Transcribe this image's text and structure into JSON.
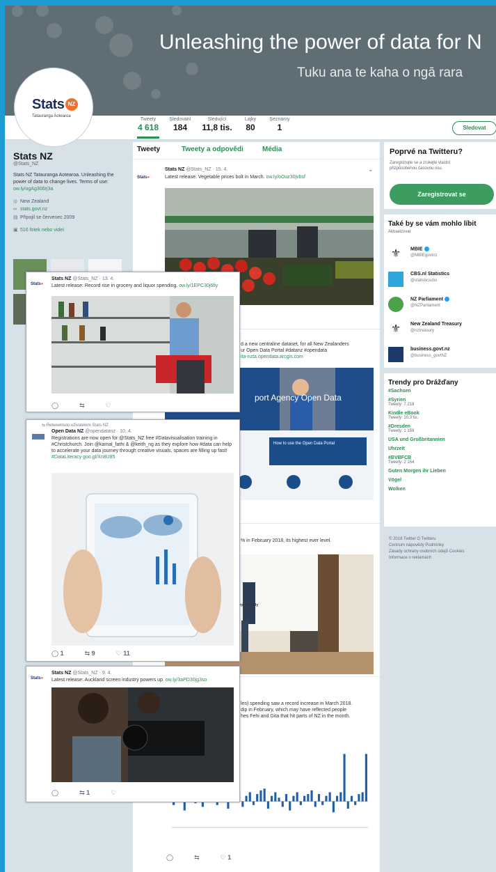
{
  "header": {
    "headline": "Unleashing the power of data for N",
    "subline": "Tuku ana te kaha o ngā rara"
  },
  "logo": {
    "word": "Stats",
    "badge": "NZ",
    "sub": "Tatauranga Aotearoa"
  },
  "stats": [
    {
      "label": "Tweety",
      "value": "4 618"
    },
    {
      "label": "Sledovaní",
      "value": "184"
    },
    {
      "label": "Sledující",
      "value": "11,8 tis."
    },
    {
      "label": "Lajky",
      "value": "80"
    },
    {
      "label": "Seznamy",
      "value": "1"
    }
  ],
  "follow_label": "Sledovat",
  "profile": {
    "name": "Stats NZ",
    "handle": "@Stats_NZ",
    "bio": "Stats NZ Tatauranga Aotearoa. Unleashing the power of data to change lives. Terms of use:",
    "bio_link": "ow.ly/ogAg306rj3a",
    "location": "New Zealand",
    "website": "stats.govt.nz",
    "joined": "Připojil se červenec 2009",
    "photos": "516 fotek nebo videí"
  },
  "tabs": [
    "Tweety",
    "Tweety a odpovědi",
    "Média"
  ],
  "tweets": {
    "t1": {
      "name": "Stats NZ",
      "meta": "@Stats_NZ · 15. 4.",
      "text": "Latest release: Vegetable prices bolt in March.",
      "link": "ow.ly/oOuz30jvbsf"
    },
    "t2": {
      "text": "d a new centraline dataset, for all New Zealanders",
      "text2": "ur Open Data Portal #datanz #opendata",
      "link": "ita-nzta.opendata.arcgis.com"
    },
    "banner": "port Agency Open Data",
    "portal": "How to use the Open Data Portal",
    "t3": {
      "text": "% in February 2018, its highest ever level."
    },
    "t4": {
      "text": "les) spending saw a record increase in March 2018.",
      "text2": "dip in February, which may have reflected people",
      "text3": "hes Fehi and Gita that hit parts of NZ in the month."
    },
    "chart_title": "ers retail card spending, consumables industry, monthly"
  },
  "cards": {
    "c1": {
      "name": "Stats NZ",
      "meta": "@Stats_NZ · 13. 4.",
      "text": "Latest release: Record rise in grocery and liquor spending.",
      "link": "ow.ly/1EPC30j6fiy"
    },
    "c2": {
      "retweet": "Retweetnuto uživatelem Stats NZ",
      "name": "Open Data NZ",
      "meta": "@opendatanz · 10. 4.",
      "text": "Registrations are now open for @Stats_NZ free #Datavisualisation training in #Christchurch. Join @kamal_fathi & @keith_ng as they explore how #data can help to accelerate your data journey through creative visuals, spaces are filling up fast!",
      "link": "#DataLiteracy goo.gl/Xn8U85",
      "reply": "1",
      "rt": "9",
      "like": "11"
    },
    "c3": {
      "name": "Stats NZ",
      "meta": "@Stats_NZ · 9. 4.",
      "text": "Latest release: Auckland screen industry powers up.",
      "link": "ow.ly/3aPD30jg3so",
      "rt": "1"
    }
  },
  "bottom_actions": {
    "like": "1"
  },
  "signup": {
    "heading": "Poprvé na Twitteru?",
    "text": "Zaregistrujte se a získejte vlastní přizpůsobenou časovou osu.",
    "button": "Zaregistrovat se"
  },
  "suggestions": {
    "heading": "Také by se vám mohlo líbit",
    "refresh": "Aktualizovat",
    "items": [
      {
        "name": "MBIE",
        "handle": "@MBIEgovtnz"
      },
      {
        "name": "CBS.nl Statistics",
        "handle": "@statisticscbs"
      },
      {
        "name": "NZ Parliament",
        "handle": "@NZParliament"
      },
      {
        "name": "New Zealand Treasury",
        "handle": "@nztreasury"
      },
      {
        "name": "business.govt.nz",
        "handle": "@business_govtNZ"
      }
    ]
  },
  "trends": {
    "heading": "Trendy pro Drážďany",
    "items": [
      {
        "name": "#Sachsen",
        "sub": ""
      },
      {
        "name": "#Syrien",
        "sub": "Tweety: 7 218"
      },
      {
        "name": "Kindle eBook",
        "sub": "Tweety: 10,3 tis."
      },
      {
        "name": "#Dresden",
        "sub": "Tweety: 1 159"
      },
      {
        "name": "USA und Großbritannien",
        "sub": ""
      },
      {
        "name": "Uhrzeit",
        "sub": ""
      },
      {
        "name": "#BVBFCB",
        "sub": "Tweety: 2 154"
      },
      {
        "name": "Guten Morgen ihr Lieben",
        "sub": ""
      },
      {
        "name": "Vögel",
        "sub": ""
      },
      {
        "name": "Wolken",
        "sub": ""
      }
    ]
  },
  "footer": {
    "l1": "© 2018 Twitter   O Twitteru",
    "l2": "Centrum nápovědy   Podmínky",
    "l3": "Zásady ochrany osobních údajů   Cookies",
    "l4": "Informace o reklamách"
  },
  "chart_data": {
    "type": "bar",
    "title": "ers retail card spending, consumables industry, monthly",
    "ylim": [
      -12,
      30
    ],
    "values": [
      -2,
      4,
      3,
      -5,
      3,
      5,
      -1,
      4,
      -3,
      2,
      3,
      6,
      -2,
      3,
      5,
      -4,
      2,
      4,
      6,
      -3,
      3,
      5,
      -2,
      4,
      6,
      7,
      -4,
      3,
      5,
      2,
      -3,
      4,
      -5,
      3,
      5,
      -2,
      3,
      4,
      6,
      -3,
      4,
      -2,
      3,
      5,
      -6,
      3,
      5,
      26,
      -4,
      3,
      -2,
      4,
      5,
      26
    ]
  }
}
